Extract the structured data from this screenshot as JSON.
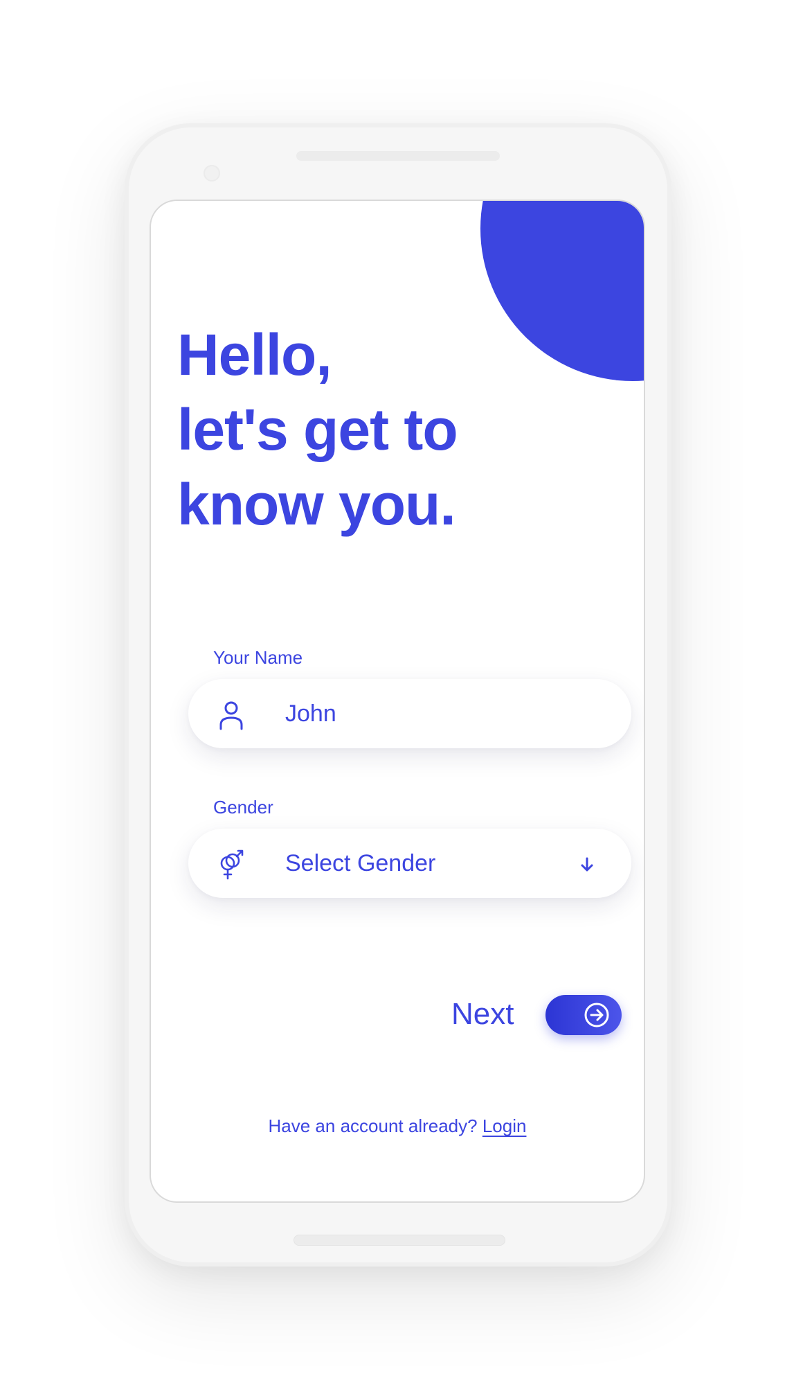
{
  "colors": {
    "accent": "#3c45e0",
    "screen_bg": "#ffffff",
    "device_frame": "#f6f6f6"
  },
  "heading": {
    "line1": "Hello,",
    "line2": "let's get to",
    "line3": "know you."
  },
  "form": {
    "name": {
      "label": "Your Name",
      "icon": "user-icon",
      "value": "John"
    },
    "gender": {
      "label": "Gender",
      "icon": "gender-icon",
      "selected": "Select Gender",
      "dropdown_icon": "arrow-down-icon"
    }
  },
  "actions": {
    "next_label": "Next",
    "next_icon": "arrow-right-circle-icon"
  },
  "footer": {
    "prompt": "Have an account already?",
    "login_link": "Login"
  }
}
